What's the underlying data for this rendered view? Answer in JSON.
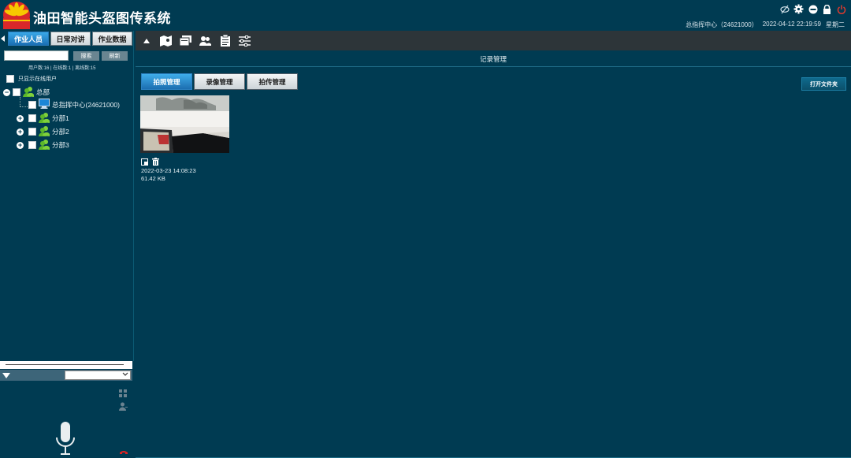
{
  "app": {
    "title": "油田智能头盔图传系统"
  },
  "status": {
    "center": "总指挥中心（24621000）",
    "datetime": "2022-04-12 22:19:59",
    "weekday": "星期二"
  },
  "top_icons": [
    "eye-slash-icon",
    "gear-icon",
    "minimize-icon",
    "lock-icon",
    "power-icon"
  ],
  "left_tabs": [
    {
      "label": "作业人员",
      "active": true
    },
    {
      "label": "日常对讲",
      "active": false
    },
    {
      "label": "作业数据",
      "active": false
    }
  ],
  "search": {
    "placeholder": "",
    "search_label": "搜索",
    "refresh_label": "刷新"
  },
  "user_stats": "用户数:16 | 在线数:1 | 离线数:15",
  "online_only_label": "只显示在线用户",
  "tree": {
    "root": "总部",
    "command_center": "总指挥中心(24621000)",
    "branches": [
      "分部1",
      "分部2",
      "分部3"
    ]
  },
  "toolbar_icons": [
    "collapse-up-icon",
    "map-icon",
    "cards-icon",
    "users-icon",
    "clipboard-icon",
    "sliders-icon"
  ],
  "main": {
    "section_title": "记录管理",
    "sub_tabs": [
      {
        "label": "拍照管理",
        "active": true
      },
      {
        "label": "录像管理",
        "active": false
      },
      {
        "label": "拍传管理",
        "active": false
      }
    ],
    "open_folder_label": "打开文件夹",
    "items": [
      {
        "timestamp": "2022-03-23 14:08:23",
        "size": "61.42 KB"
      }
    ]
  },
  "colors": {
    "background": "#003b52",
    "toolbar": "#2d3539",
    "active_tab": "#2a8fd6",
    "power": "#e03a2e"
  }
}
